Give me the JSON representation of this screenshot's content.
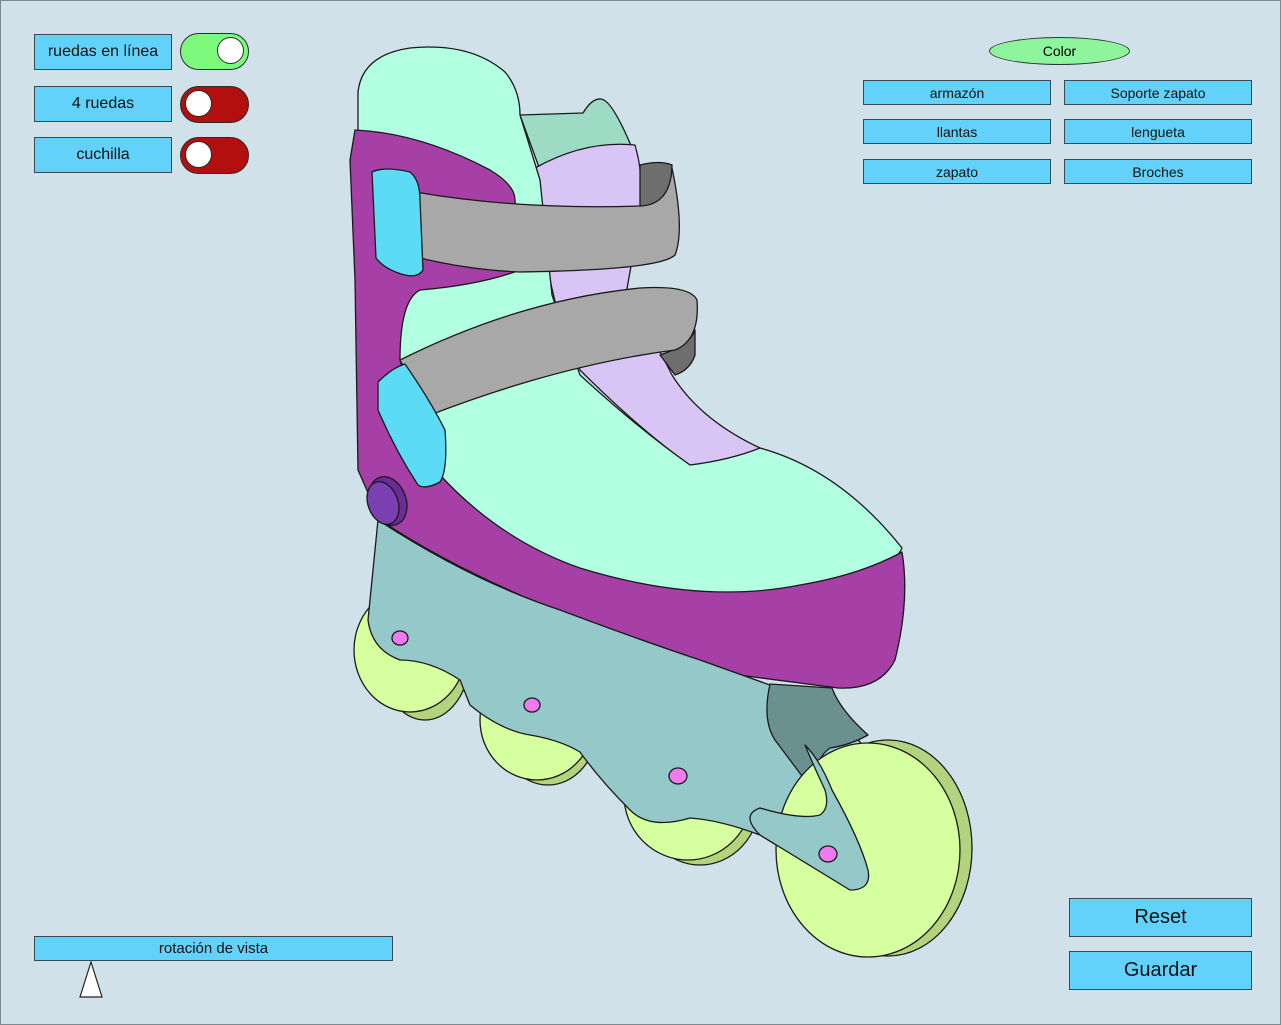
{
  "modes": [
    {
      "label": "ruedas en línea",
      "state": "on",
      "toggle_color": "#7dfa7d"
    },
    {
      "label": "4 ruedas",
      "state": "off",
      "toggle_color": "#b30f0f"
    },
    {
      "label": "cuchilla",
      "state": "off",
      "toggle_color": "#b30f0f"
    }
  ],
  "color_panel": {
    "title": "Color",
    "parts": [
      "armazón",
      "Soporte zapato",
      "llantas",
      "lengueta",
      "zapato",
      "Broches"
    ]
  },
  "actions": {
    "reset": "Reset",
    "save": "Guardar"
  },
  "view_rotation": {
    "label": "rotación de vista",
    "value": 0
  },
  "colors": {
    "background": "#d0e1ea",
    "button": "#63d2fb",
    "shoe": "#b2ffe2",
    "shoe_support": "#a63fa6",
    "tongue": "#d8c5f5",
    "straps": "#a8a8a8",
    "buckles": "#5bdbf5",
    "frame": "#95c9c9",
    "wheels": "#d6ff9f",
    "bolts": "#f07aef"
  }
}
